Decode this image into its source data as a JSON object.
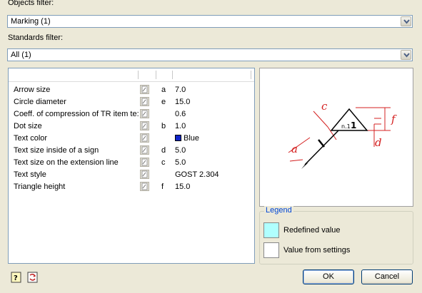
{
  "objects_filter": {
    "label": "Objects filter:",
    "value": "Marking (1)"
  },
  "standards_filter": {
    "label": "Standards filter:",
    "value": "All (1)"
  },
  "properties": [
    {
      "name": "Arrow size",
      "var": "a",
      "value": "7.0"
    },
    {
      "name": "Circle diameter",
      "var": "e",
      "value": "15.0"
    },
    {
      "name": "Coeff. of compression of TR item te:",
      "var": "",
      "value": "0.6"
    },
    {
      "name": "Dot size",
      "var": "b",
      "value": "1.0"
    },
    {
      "name": "Text color",
      "var": "",
      "value": "Blue",
      "swatch": "#1024c8"
    },
    {
      "name": "Text size inside of a sign",
      "var": "d",
      "value": "5.0"
    },
    {
      "name": "Text size on the extension line",
      "var": "c",
      "value": "5.0"
    },
    {
      "name": "Text style",
      "var": "",
      "value": "GOST 2.304"
    },
    {
      "name": "Triangle height",
      "var": "f",
      "value": "15.0"
    }
  ],
  "preview": {
    "labels": {
      "c": "c",
      "a": "a",
      "d": "d",
      "f": "f",
      "n1": "n.1",
      "one": "1"
    }
  },
  "legend": {
    "title": "Legend",
    "redefined_label": "Redefined value",
    "redefined_color": "#b0ffff",
    "settings_label": "Value from settings"
  },
  "buttons": {
    "ok": "OK",
    "cancel": "Cancel"
  }
}
